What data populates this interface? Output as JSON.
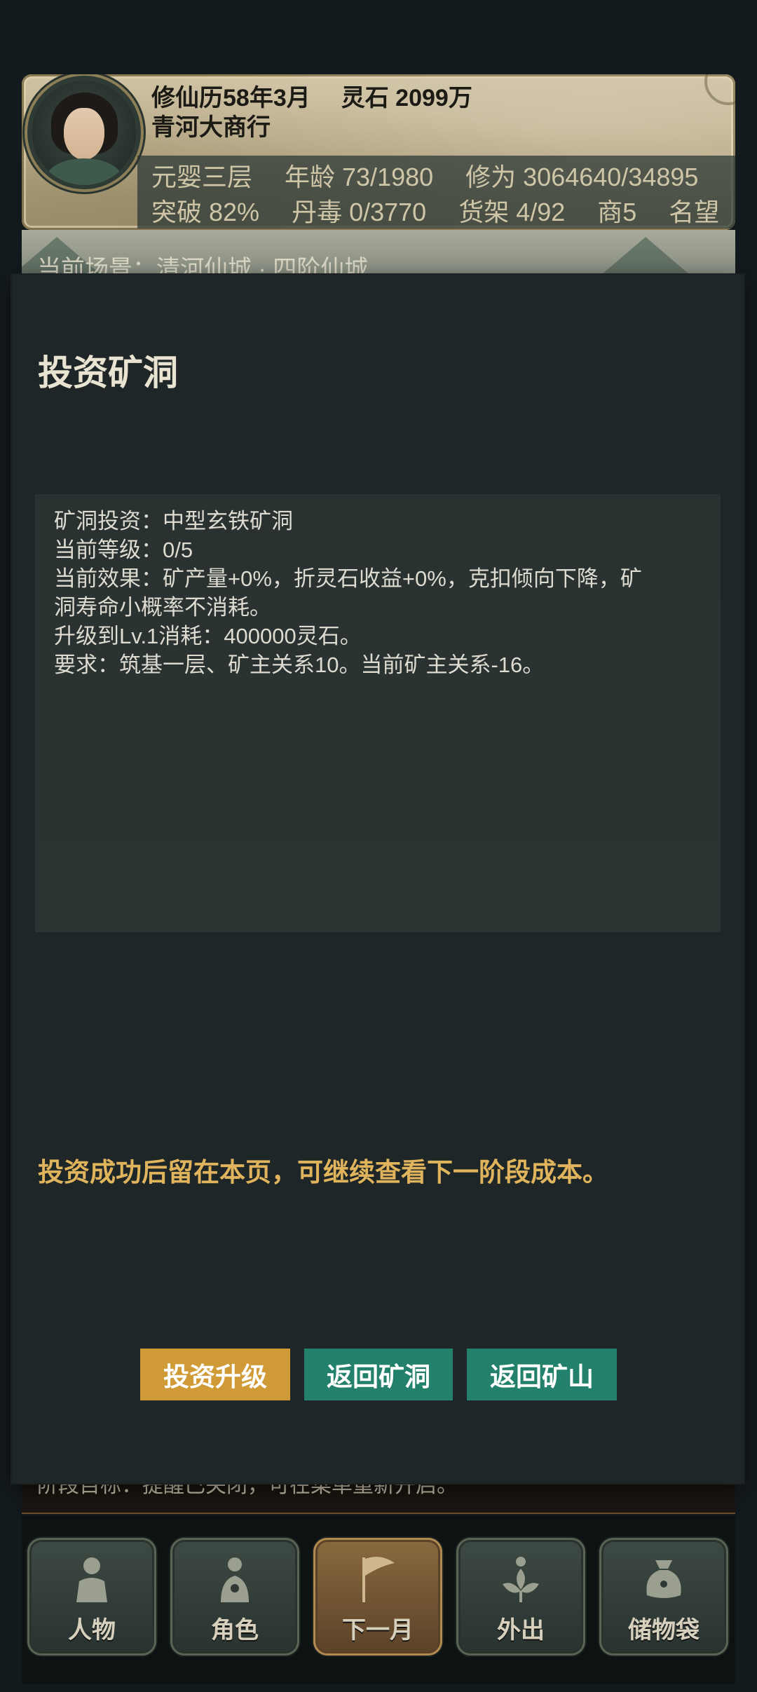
{
  "header": {
    "calendar": "修仙历58年3月",
    "spirit_stones": "灵石 2099万",
    "shop_name": "青河大商行",
    "stats_row1": [
      "元婴三层",
      "年龄 73/1980",
      "修为 3064640/34895"
    ],
    "stats_row2": [
      "突破 82%",
      "丹毒 0/3770",
      "货架 4/92",
      "商5",
      "名望"
    ]
  },
  "scene": {
    "text": "当前场景：清河仙城 · 四阶仙城"
  },
  "background_status": {
    "text": "阶段目标：提醒已关闭，可在菜单重新开启。"
  },
  "modal": {
    "title": "投资矿洞",
    "info_lines": [
      "矿洞投资：中型玄铁矿洞",
      "当前等级：0/5",
      "当前效果：矿产量+0%，折灵石收益+0%，克扣倾向下降，矿",
      "洞寿命小概率不消耗。",
      "升级到Lv.1消耗：400000灵石。",
      "要求：筑基一层、矿主关系10。当前矿主关系-16。"
    ],
    "notice": "投资成功后留在本页，可继续查看下一阶段成本。",
    "buttons": {
      "invest": "投资升级",
      "return_cave": "返回矿洞",
      "return_mine": "返回矿山"
    }
  },
  "nav": {
    "items": [
      {
        "label": "人物",
        "icon": "person-icon"
      },
      {
        "label": "角色",
        "icon": "character-icon"
      },
      {
        "label": "下一月",
        "icon": "flag-icon"
      },
      {
        "label": "外出",
        "icon": "lotus-icon"
      },
      {
        "label": "储物袋",
        "icon": "bag-icon"
      }
    ]
  },
  "colors": {
    "modal_bg": "#1f2627",
    "info_bg": "#2a3232",
    "notice": "#e0b45c",
    "primary_button": "#d09b36",
    "secondary_button": "#23806a"
  }
}
